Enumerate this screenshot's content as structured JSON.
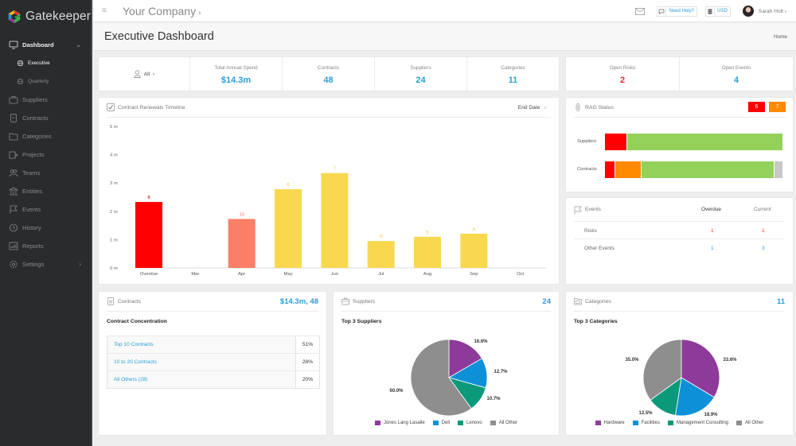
{
  "app": {
    "name": "Gatekeeper"
  },
  "sidebar": {
    "items": [
      {
        "label": "Dashboard",
        "icon": "monitor-icon",
        "active": true,
        "caret": "⌄"
      },
      {
        "label": "Executive",
        "icon": "globe-icon",
        "active": true,
        "sub": true
      },
      {
        "label": "Quarterly",
        "icon": "globe-icon",
        "sub": true
      },
      {
        "label": "Suppliers",
        "icon": "briefcase-icon"
      },
      {
        "label": "Contracts",
        "icon": "document-icon"
      },
      {
        "label": "Categories",
        "icon": "folder-icon"
      },
      {
        "label": "Projects",
        "icon": "project-icon"
      },
      {
        "label": "Teams",
        "icon": "team-icon"
      },
      {
        "label": "Entities",
        "icon": "building-icon"
      },
      {
        "label": "Events",
        "icon": "flag-icon"
      },
      {
        "label": "History",
        "icon": "clock-icon"
      },
      {
        "label": "Reports",
        "icon": "report-icon"
      },
      {
        "label": "Settings",
        "icon": "gear-icon",
        "caret": "›"
      }
    ]
  },
  "topbar": {
    "company": "Your Company",
    "company_chevron": "›",
    "help_label": "Need Help?",
    "currency_label": "USD",
    "user_name": "Sarah Holt",
    "user_chevron": "›"
  },
  "page": {
    "title": "Executive Dashboard",
    "breadcrumb": "Home"
  },
  "kpis": {
    "filter_label": "All",
    "filter_chevron": "›",
    "items": [
      {
        "label": "Total Annual Spend",
        "value": "$14.3m"
      },
      {
        "label": "Contracts",
        "value": "48"
      },
      {
        "label": "Suppliers",
        "value": "24"
      },
      {
        "label": "Categories",
        "value": "11"
      }
    ],
    "risk_items": [
      {
        "label": "Open Risks",
        "value": "2"
      },
      {
        "label": "Open Events",
        "value": "4"
      }
    ]
  },
  "renewals": {
    "title": "Contract Renewals Timeline",
    "sort_label": "End Date",
    "sort_chevron": "›"
  },
  "chart_data": {
    "type": "bar",
    "title": "Contract Renewals Timeline",
    "xlabel": "",
    "ylabel": "",
    "ylim": [
      0,
      5
    ],
    "y_ticks": [
      "0 m",
      "1 m",
      "2 m",
      "3 m",
      "4 m",
      "5 m"
    ],
    "categories": [
      "Overdue",
      "Mar",
      "Apr",
      "May",
      "Jun",
      "Jul",
      "Aug",
      "Sep",
      "Oct"
    ],
    "values": [
      2.33,
      0,
      1.73,
      2.78,
      3.35,
      0.95,
      1.1,
      1.21,
      0
    ],
    "data_labels": [
      "9",
      "",
      "10",
      "6",
      "7",
      "3",
      "5",
      "5",
      ""
    ],
    "colors": [
      "#ff0000",
      "",
      "#fa7f67",
      "#f8d84f",
      "#f8d84f",
      "#f8d84f",
      "#f8d84f",
      "#f8d84f",
      ""
    ],
    "label_colors": [
      "#e0312f",
      "",
      "#f07060",
      "#f0c830",
      "#f0c830",
      "#f0c830",
      "#f0c830",
      "#f0c830",
      ""
    ],
    "grid": false
  },
  "rag": {
    "title": "RAG Status",
    "badges": [
      {
        "value": "6",
        "color": "#ff0000"
      },
      {
        "value": "7",
        "color": "#ff8a00"
      }
    ],
    "rows": [
      {
        "label": "Suppliers",
        "segments": [
          {
            "pct": 12.5,
            "color": "#ff0000"
          },
          {
            "pct": 87.5,
            "color": "#93d15a"
          }
        ]
      },
      {
        "label": "Contracts",
        "segments": [
          {
            "pct": 6,
            "color": "#ff0000"
          },
          {
            "pct": 14.5,
            "color": "#ff8a00"
          },
          {
            "pct": 75,
            "color": "#93d15a"
          },
          {
            "pct": 4.5,
            "color": "#c8c8c8"
          }
        ]
      }
    ]
  },
  "events": {
    "title": "Events",
    "columns": [
      "Overdue",
      "Current"
    ],
    "rows": [
      {
        "label": "Risks",
        "overdue": "1",
        "current": "1",
        "color": "#e0312f"
      },
      {
        "label": "Other Events",
        "overdue": "1",
        "current": "3",
        "color": "#2a9fd6"
      }
    ]
  },
  "contracts_panel": {
    "title": "Contracts",
    "value": "$14.3m, 48",
    "subtitle": "Contract Concentration",
    "rows": [
      {
        "label": "Top 10 Contracts",
        "value": "51%"
      },
      {
        "label": "10 to 20 Contracts",
        "value": "28%"
      },
      {
        "label": "All Others (28)",
        "value": "20%"
      }
    ]
  },
  "suppliers_panel": {
    "title": "Suppliers",
    "value": "24",
    "subtitle": "Top 3 Suppliers",
    "pie": {
      "type": "pie",
      "slices": [
        {
          "label": "Jones Lang Lasalle",
          "value": 16.6,
          "text": "16.6%",
          "color": "#8e3a9b"
        },
        {
          "label": "Dell",
          "value": 12.7,
          "text": "12.7%",
          "color": "#0d90d8"
        },
        {
          "label": "Lenovo",
          "value": 10.7,
          "text": "10.7%",
          "color": "#0a9a7a"
        },
        {
          "label": "All Other",
          "value": 60.0,
          "text": "60.0%",
          "color": "#8e8e8e"
        }
      ]
    }
  },
  "categories_panel": {
    "title": "Categories",
    "value": "11",
    "subtitle": "Top 3 Categories",
    "pie": {
      "type": "pie",
      "slices": [
        {
          "label": "Hardware",
          "value": 33.6,
          "text": "33.6%",
          "color": "#8e3a9b"
        },
        {
          "label": "Facilities",
          "value": 18.9,
          "text": "18.9%",
          "color": "#0d90d8"
        },
        {
          "label": "Management Consulting",
          "value": 12.5,
          "text": "12.5%",
          "color": "#0a9a7a"
        },
        {
          "label": "All Other",
          "value": 35.0,
          "text": "35.0%",
          "color": "#8e8e8e"
        }
      ]
    }
  }
}
